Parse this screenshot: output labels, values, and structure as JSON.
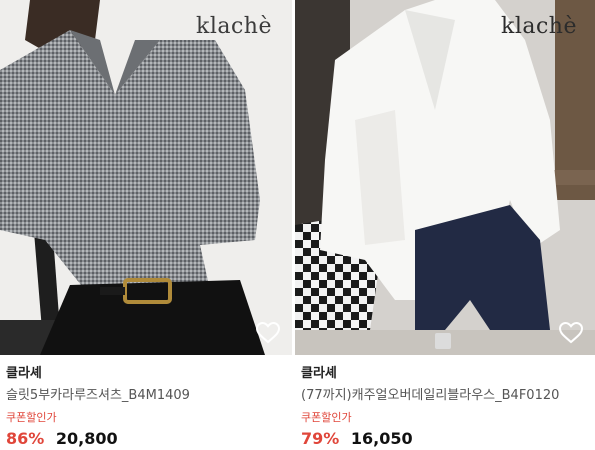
{
  "products": [
    {
      "brand_logo": "klachè",
      "shop_name": "클라셰",
      "product_name": "슬릿5부카라루즈셔츠_B4M1409",
      "coupon_label": "쿠폰할인가",
      "discount": "86%",
      "price": "20,800",
      "favorite_icon": "heart-outline-icon"
    },
    {
      "brand_logo": "klachè",
      "shop_name": "클라셰",
      "product_name": "(77까지)캐주얼오버데일리블라우스_B4F0120",
      "coupon_label": "쿠폰할인가",
      "discount": "79%",
      "price": "16,050",
      "favorite_icon": "heart-outline-icon"
    }
  ],
  "colors": {
    "discount": "#e0463a",
    "coupon": "#e0463a",
    "text": "#222222"
  }
}
